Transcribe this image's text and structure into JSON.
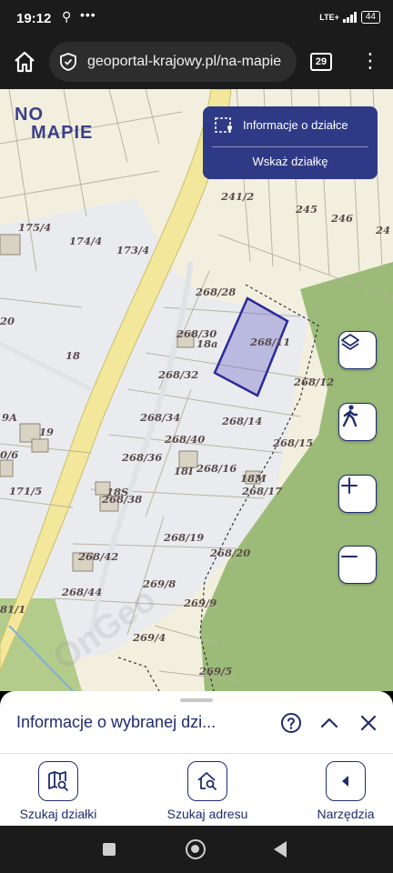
{
  "status_bar": {
    "time": "19:12",
    "network": "LTE+",
    "battery": "44"
  },
  "browser": {
    "url": "geoportal-krajowy.pl/na-mapie",
    "tab_count": "29"
  },
  "logo": {
    "line1": "NO",
    "line2": "MAPIE"
  },
  "info_panel": {
    "title": "Informacje o działce",
    "action": "Wskaż działkę"
  },
  "map_labels": [
    "175/4",
    "174/4",
    "173/4",
    "241/2",
    "245",
    "246",
    "24",
    "20",
    "18",
    "268/28",
    "268/30",
    "18a",
    "268/11",
    "268/32",
    "268/12",
    "9A",
    "19",
    "0/6",
    "268/34",
    "268/14",
    "268/40",
    "268/15",
    "268/36",
    "18I",
    "268/16",
    "18M",
    "171/5",
    "18S",
    "268/38",
    "268/17",
    "268/19",
    "268/42",
    "268/20",
    "269/8",
    "268/44",
    "81/1",
    "269/9",
    "269/4",
    "269/5"
  ],
  "map_buttons": [
    "layers-icon",
    "walking-person-icon",
    "zoom-in-icon",
    "zoom-out-icon"
  ],
  "bottom_sheet": {
    "title": "Informacje o wybranej dzi..."
  },
  "nav": {
    "search_parcel": "Szukaj działki",
    "search_address": "Szukaj adresu",
    "tools": "Narzędzia"
  },
  "colors": {
    "brand": "#2f3a86",
    "forest": "#9cbb78",
    "map_background": "#f3efdf",
    "road": "#f2e79a"
  }
}
